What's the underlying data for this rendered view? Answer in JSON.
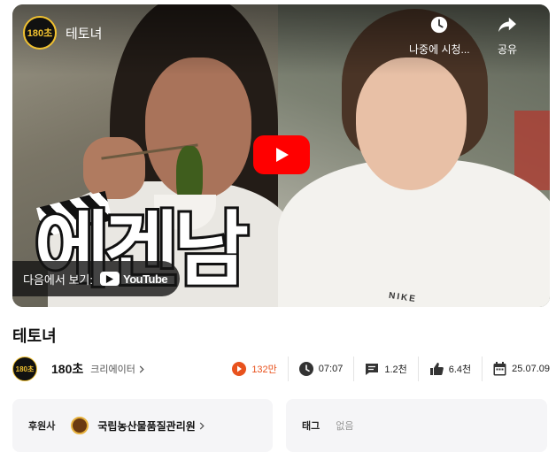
{
  "player": {
    "channel_logo_text": "180초",
    "video_title": "테토녀",
    "overlay_text": "에겐남",
    "watch_later_label": "나중에 시청...",
    "share_label": "공유",
    "watch_on_label": "다음에서 보기:",
    "youtube_label": "YouTube",
    "shirt_text": "NIKE"
  },
  "page": {
    "title": "테토녀"
  },
  "meta": {
    "channel_name": "180초",
    "channel_role": "크리에이터",
    "avatar_text": "180초",
    "views": "132만",
    "duration": "07:07",
    "comments": "1.2천",
    "likes": "6.4천",
    "date": "25.07.09"
  },
  "sponsor": {
    "label": "후원사",
    "name": "국립농산물품질관리원"
  },
  "tags": {
    "label": "태그",
    "value": "없음"
  },
  "colors": {
    "youtube_red": "#ff0000",
    "views_accent": "#e8521d",
    "card_bg": "#f5f5f7"
  }
}
